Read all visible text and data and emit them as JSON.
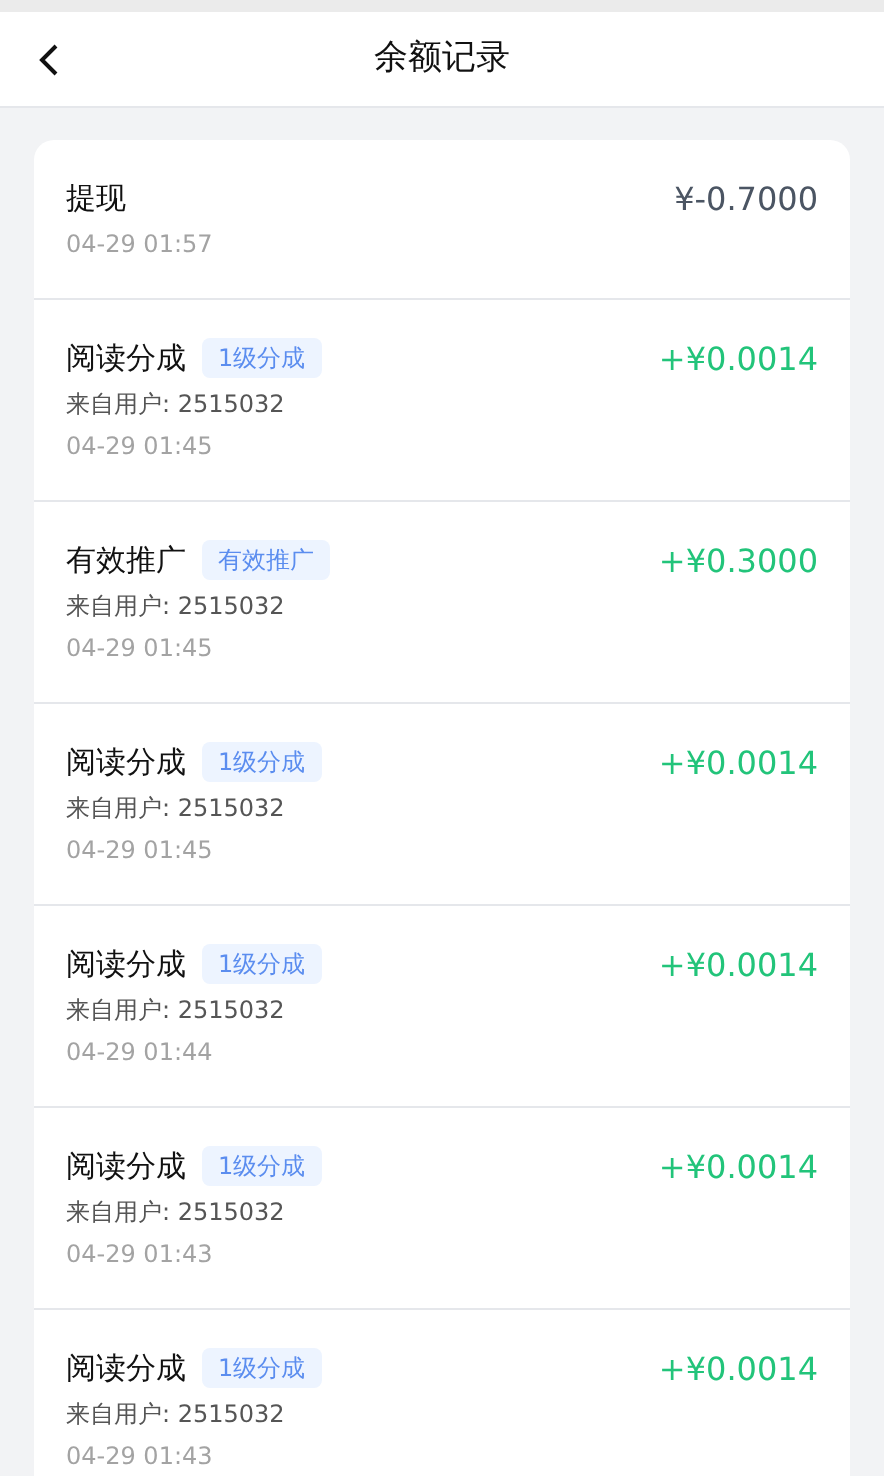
{
  "header": {
    "title": "余额记录"
  },
  "records": [
    {
      "kind": "debit",
      "title": "提现",
      "amount": "¥-0.7000",
      "time": "04-29 01:57"
    },
    {
      "kind": "credit",
      "title": "阅读分成",
      "tag": "1级分成",
      "source": "来自用户: 2515032",
      "amount": "+¥0.0014",
      "time": "04-29 01:45"
    },
    {
      "kind": "credit",
      "title": "有效推广",
      "tag": "有效推广",
      "source": "来自用户: 2515032",
      "amount": "+¥0.3000",
      "time": "04-29 01:45"
    },
    {
      "kind": "credit",
      "title": "阅读分成",
      "tag": "1级分成",
      "source": "来自用户: 2515032",
      "amount": "+¥0.0014",
      "time": "04-29 01:45"
    },
    {
      "kind": "credit",
      "title": "阅读分成",
      "tag": "1级分成",
      "source": "来自用户: 2515032",
      "amount": "+¥0.0014",
      "time": "04-29 01:44"
    },
    {
      "kind": "credit",
      "title": "阅读分成",
      "tag": "1级分成",
      "source": "来自用户: 2515032",
      "amount": "+¥0.0014",
      "time": "04-29 01:43"
    },
    {
      "kind": "credit",
      "title": "阅读分成",
      "tag": "1级分成",
      "source": "来自用户: 2515032",
      "amount": "+¥0.0014",
      "time": "04-29 01:43"
    }
  ]
}
